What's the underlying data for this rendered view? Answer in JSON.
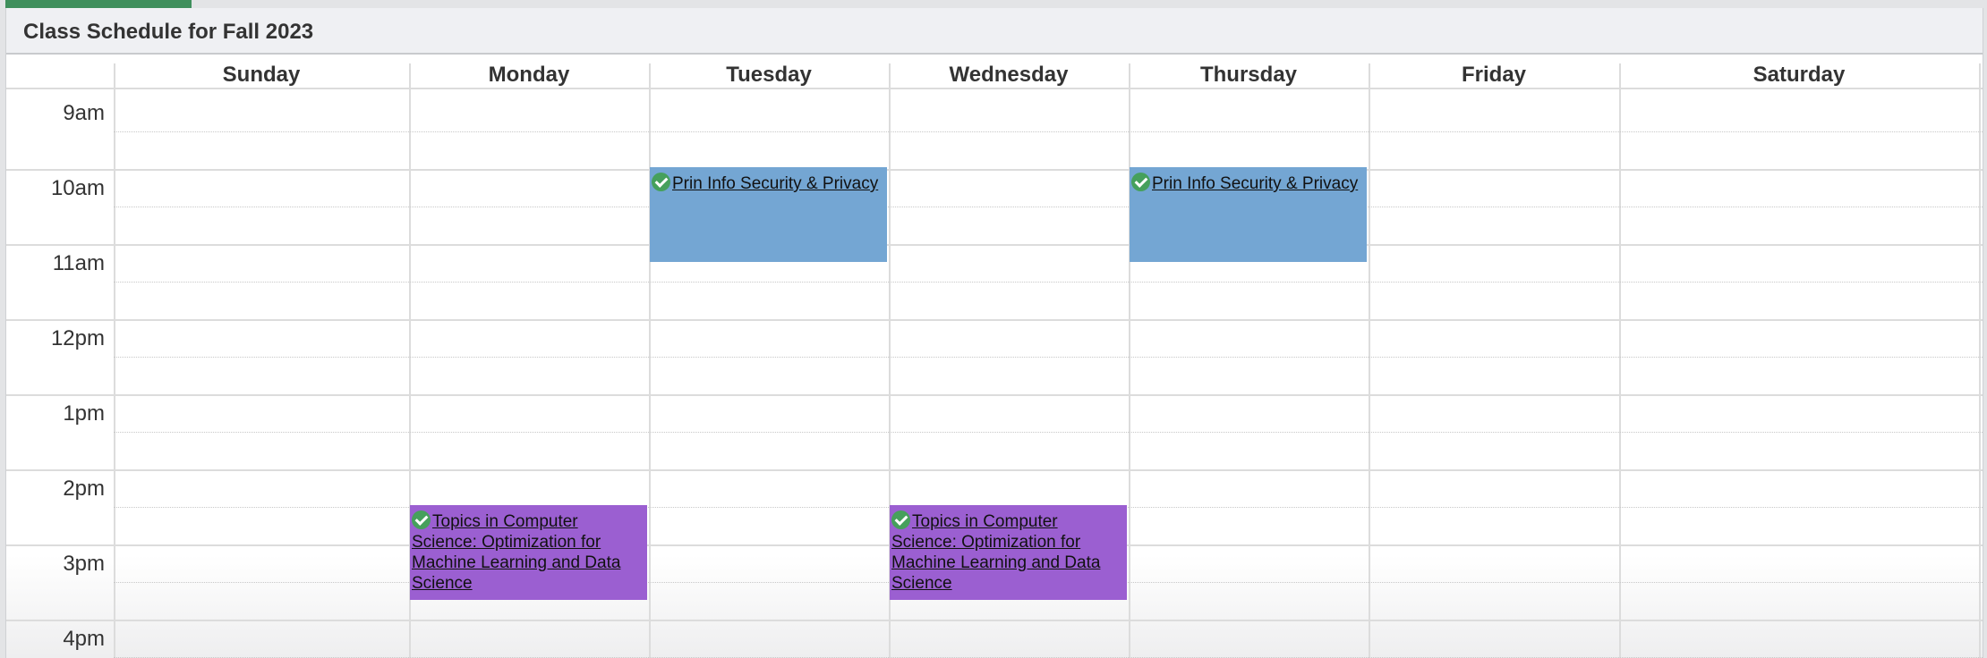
{
  "schedule": {
    "title": "Class Schedule for Fall 2023",
    "days": [
      "Sunday",
      "Monday",
      "Tuesday",
      "Wednesday",
      "Thursday",
      "Friday",
      "Saturday"
    ],
    "times": [
      "9am",
      "10am",
      "11am",
      "12pm",
      "1pm",
      "2pm",
      "3pm",
      "4pm"
    ],
    "events": [
      {
        "day": "Tuesday",
        "title": "Prin Info Security & Privacy",
        "color": "#74a6d3"
      },
      {
        "day": "Thursday",
        "title": "Prin Info Security & Privacy",
        "color": "#74a6d3"
      },
      {
        "day": "Monday",
        "title": "Topics in Computer Science: Optimization for Machine Learning and Data Science",
        "color": "#9b5fd1"
      },
      {
        "day": "Wednesday",
        "title": "Topics in Computer Science: Optimization for Machine Learning and Data Science",
        "color": "#9b5fd1"
      }
    ],
    "icons": {
      "enrolled": "check-circle-icon"
    },
    "accent_color": "#3f8f5c"
  }
}
